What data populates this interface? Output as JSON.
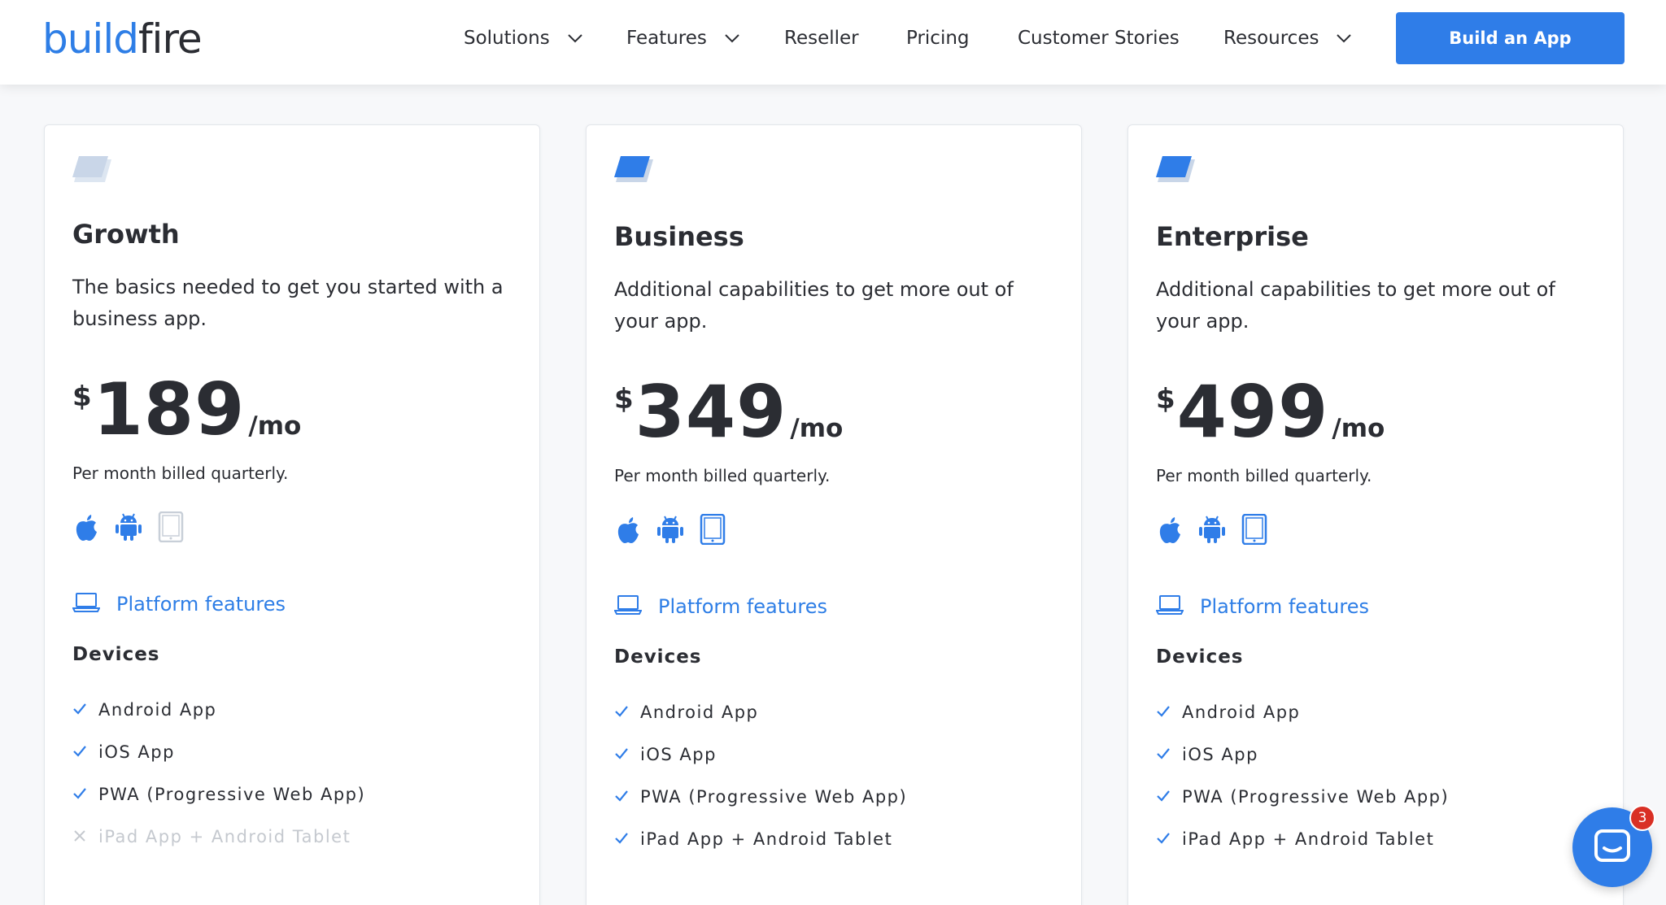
{
  "brand": {
    "logo_part1": "build",
    "logo_part2": "fire"
  },
  "nav": {
    "items": [
      {
        "label": "Solutions",
        "dropdown": true
      },
      {
        "label": "Features",
        "dropdown": true
      },
      {
        "label": "Reseller",
        "dropdown": false
      },
      {
        "label": "Pricing",
        "dropdown": false
      },
      {
        "label": "Customer Stories",
        "dropdown": false
      },
      {
        "label": "Resources",
        "dropdown": true
      }
    ],
    "cta": "Build an App"
  },
  "colors": {
    "accent": "#2f7de8",
    "text": "#2b2d33",
    "muted": "#c5c9cf"
  },
  "plans": [
    {
      "name": "Growth",
      "description": "The basics needed to get you started with a business app.",
      "currency": "$",
      "price": "189",
      "period": "/mo",
      "billing": "Per month billed quarterly.",
      "icon_active": false,
      "platforms": {
        "apple": true,
        "android": true,
        "tablet": false
      },
      "platform_link": "Platform features",
      "section_title": "Devices",
      "features": [
        {
          "label": "Android App",
          "included": true
        },
        {
          "label": "iOS App",
          "included": true
        },
        {
          "label": "PWA (Progressive Web App)",
          "included": true
        },
        {
          "label": "iPad App + Android Tablet",
          "included": false
        }
      ]
    },
    {
      "name": "Business",
      "description": "Additional capabilities to get more out of your app.",
      "currency": "$",
      "price": "349",
      "period": "/mo",
      "billing": "Per month billed quarterly.",
      "icon_active": true,
      "platforms": {
        "apple": true,
        "android": true,
        "tablet": true
      },
      "platform_link": "Platform features",
      "section_title": "Devices",
      "features": [
        {
          "label": "Android App",
          "included": true
        },
        {
          "label": "iOS App",
          "included": true
        },
        {
          "label": "PWA (Progressive Web App)",
          "included": true
        },
        {
          "label": "iPad App + Android Tablet",
          "included": true
        }
      ]
    },
    {
      "name": "Enterprise",
      "description": "Additional capabilities to get more out of your app.",
      "currency": "$",
      "price": "499",
      "period": "/mo",
      "billing": "Per month billed quarterly.",
      "icon_active": true,
      "platforms": {
        "apple": true,
        "android": true,
        "tablet": true
      },
      "platform_link": "Platform features",
      "section_title": "Devices",
      "features": [
        {
          "label": "Android App",
          "included": true
        },
        {
          "label": "iOS App",
          "included": true
        },
        {
          "label": "PWA (Progressive Web App)",
          "included": true
        },
        {
          "label": "iPad App + Android Tablet",
          "included": true
        }
      ]
    }
  ],
  "chat": {
    "unread_count": "3"
  }
}
